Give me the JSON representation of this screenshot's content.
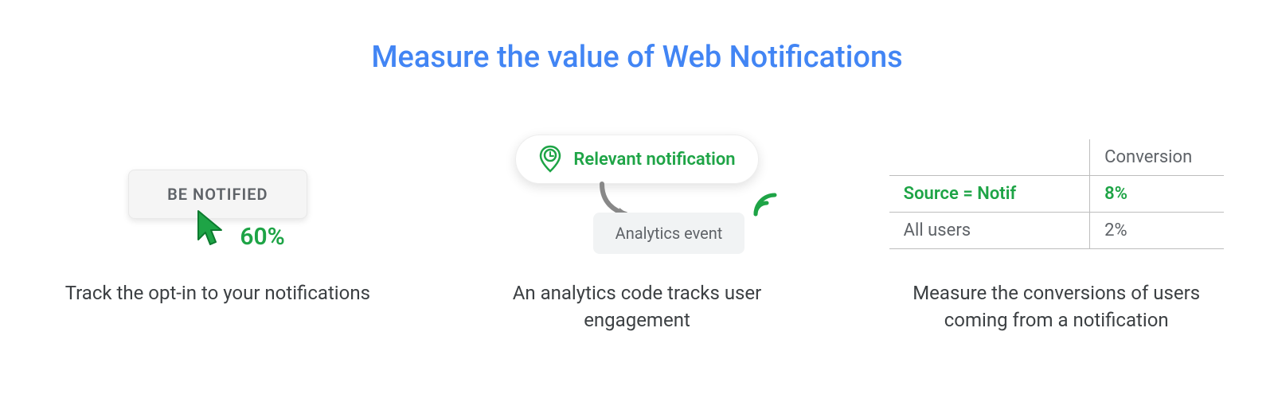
{
  "title": "Measure the value of Web Notifications",
  "col1": {
    "button_label": "BE NOTIFIED",
    "percentage": "60%",
    "caption": "Track the opt-in to your notifications"
  },
  "col2": {
    "notification_label": "Relevant notification",
    "analytics_label": "Analytics event",
    "caption": "An analytics code tracks user engagement"
  },
  "col3": {
    "header_label": "",
    "header_value": "Conversion",
    "rows": [
      {
        "label": "Source = Notif",
        "value": "8%",
        "highlight": true
      },
      {
        "label": "All users",
        "value": "2%",
        "highlight": false
      }
    ],
    "caption": "Measure the conversions of users coming from a notification"
  }
}
